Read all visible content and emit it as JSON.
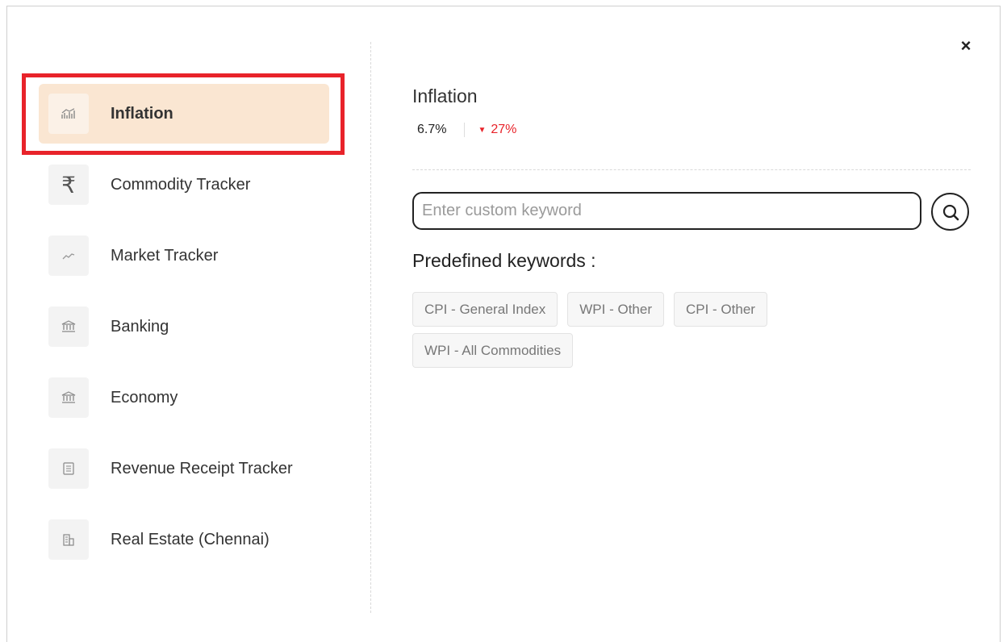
{
  "close_label": "×",
  "sidebar": {
    "items": [
      {
        "label": "Inflation",
        "icon": "chart-icon",
        "active": true
      },
      {
        "label": "Commodity Tracker",
        "icon": "rupee-icon"
      },
      {
        "label": "Market Tracker",
        "icon": "trend-line-icon"
      },
      {
        "label": "Banking",
        "icon": "bank-icon"
      },
      {
        "label": "Economy",
        "icon": "bank-icon"
      },
      {
        "label": "Revenue Receipt Tracker",
        "icon": "document-icon"
      },
      {
        "label": "Real Estate (Chennai)",
        "icon": "building-icon"
      }
    ]
  },
  "panel": {
    "title": "Inflation",
    "value": "6.7%",
    "change": "27%",
    "change_direction": "down",
    "change_color": "#e8232a"
  },
  "search": {
    "placeholder": "Enter custom keyword",
    "value": ""
  },
  "predefined": {
    "title": "Predefined keywords :",
    "chips": [
      "CPI - General Index",
      "WPI - Other",
      "CPI - Other",
      "WPI - All Commodities"
    ]
  },
  "colors": {
    "active_bg": "#fae6d2",
    "highlight_border": "#e8232a"
  }
}
